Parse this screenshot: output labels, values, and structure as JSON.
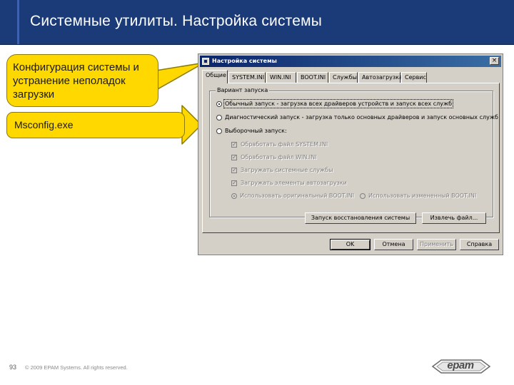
{
  "slide": {
    "title": "Системные утилиты. Настройка системы",
    "page_number": "93",
    "copyright": "© 2009 EPAM Systems. All rights reserved.",
    "logo_text": "epam"
  },
  "callouts": [
    {
      "lines": [
        "Конфигурация системы и",
        "устранение неполадок",
        "загрузки"
      ]
    },
    {
      "lines": [
        "Msconfig.exe"
      ]
    }
  ],
  "dialog": {
    "title": "Настройка системы",
    "close_glyph": "×",
    "tabs": [
      {
        "label": "Общие",
        "active": true
      },
      {
        "label": "SYSTEM.INI"
      },
      {
        "label": "WIN.INI"
      },
      {
        "label": "BOOT.INI"
      },
      {
        "label": "Службы"
      },
      {
        "label": "Автозагрузка"
      },
      {
        "label": "Сервис"
      }
    ],
    "startup_group": {
      "legend": "Вариант запуска",
      "options": [
        {
          "label": "Обычный запуск - загрузка всех драйверов устройств и запуск всех служб",
          "selected": true
        },
        {
          "label": "Диагностический запуск - загрузка только основных драйверов и запуск основных служб",
          "selected": false
        },
        {
          "label": "Выборочный запуск:",
          "selected": false
        }
      ],
      "selective_items": [
        {
          "label": "Обработать файл SYSTEM.INI",
          "checked": true
        },
        {
          "label": "Обработать файл WIN.INI",
          "checked": true
        },
        {
          "label": "Загружать системные службы",
          "checked": true
        },
        {
          "label": "Загружать элементы автозагрузки",
          "checked": true
        }
      ],
      "boot_options": [
        {
          "label": "Использовать оригинальный BOOT.INI",
          "selected": true
        },
        {
          "label": "Использовать измененный BOOT.INI",
          "selected": false
        }
      ],
      "buttons": {
        "restore": "Запуск восстановления системы",
        "expand": "Извлечь файл..."
      }
    },
    "buttons": {
      "ok": "OK",
      "cancel": "Отмена",
      "apply": "Применить",
      "help": "Справка"
    }
  },
  "colors": {
    "header_bg": "#1b3a78",
    "callout_fill": "#ffd800",
    "titlebar_start": "#0a246a",
    "window_face": "#d4d0c8"
  }
}
